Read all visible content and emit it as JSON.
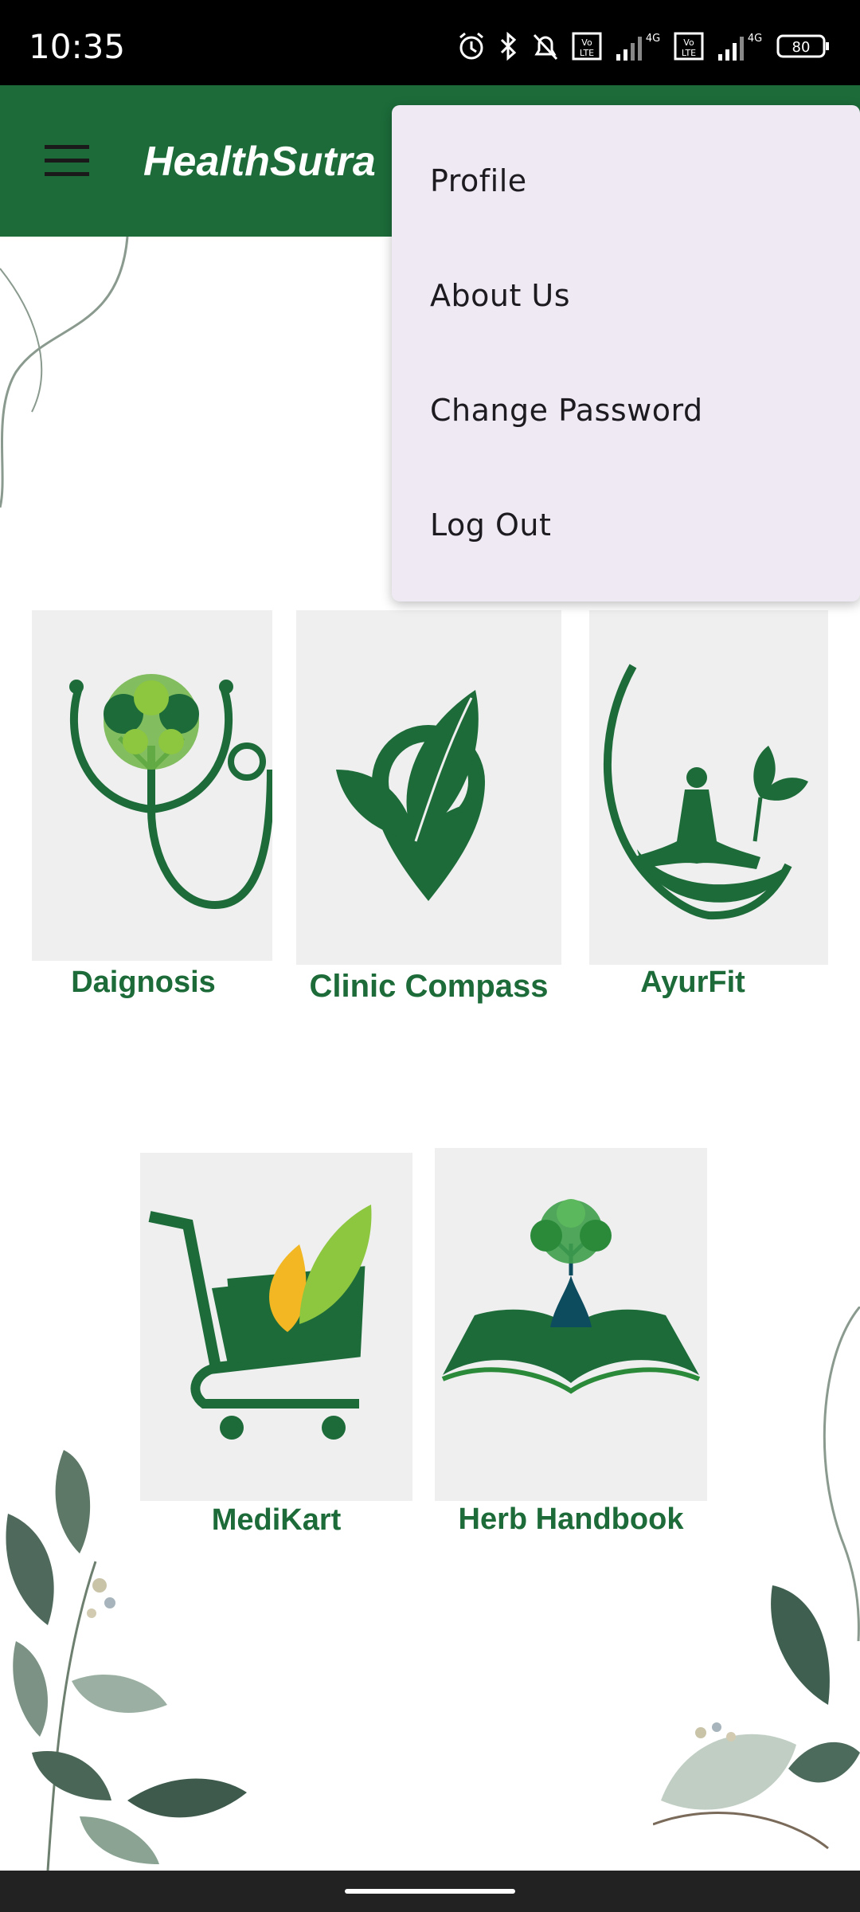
{
  "status_bar": {
    "time": "10:35",
    "battery": "80",
    "network": "4G",
    "icons": [
      "alarm-icon",
      "bluetooth-icon",
      "bell-off-icon",
      "volte-icon",
      "signal-icon",
      "battery-icon"
    ]
  },
  "app_bar": {
    "title": "HealthSutra",
    "background": "#1c6b39"
  },
  "overflow_menu": {
    "items": [
      {
        "label": "Profile"
      },
      {
        "label": "About Us"
      },
      {
        "label": "Change Password"
      },
      {
        "label": "Log Out"
      }
    ]
  },
  "features": {
    "accent": "#1c6b39",
    "tiles": [
      {
        "label": "Daignosis",
        "icon": "stethoscope-tree-icon"
      },
      {
        "label": "Clinic Compass",
        "icon": "leaf-location-pin-icon"
      },
      {
        "label": "AyurFit",
        "icon": "yoga-meditation-icon"
      },
      {
        "label": "MediKart",
        "icon": "shopping-cart-leaf-icon"
      },
      {
        "label": "Herb Handbook",
        "icon": "book-tree-icon"
      }
    ]
  }
}
